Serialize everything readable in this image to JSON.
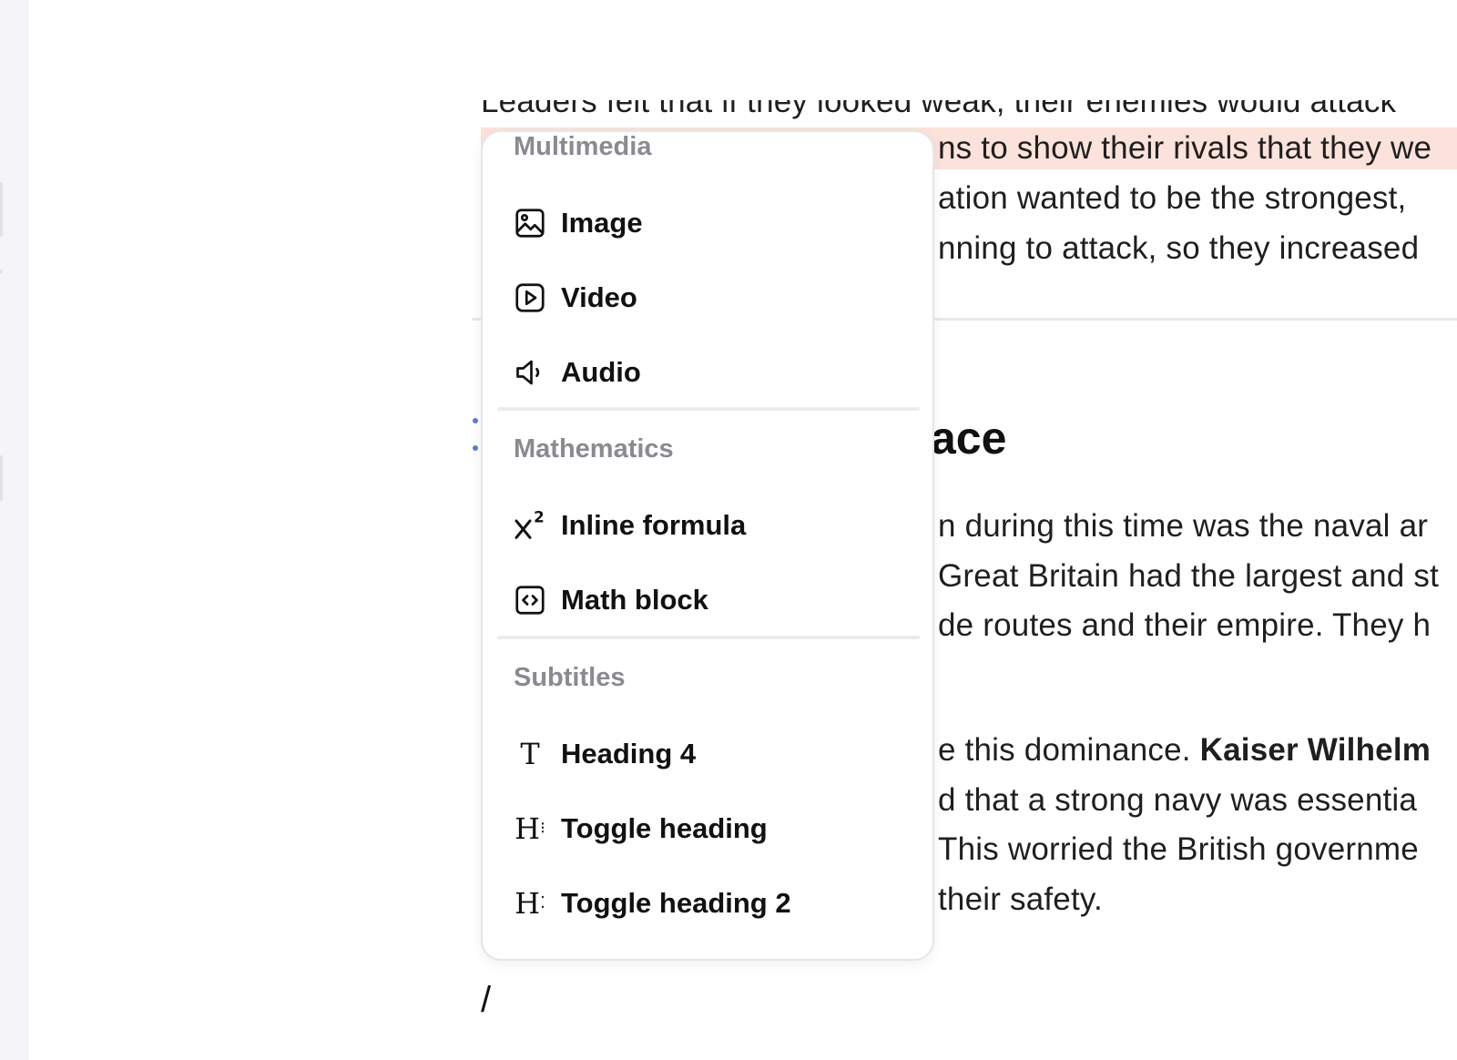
{
  "document": {
    "partial_top_line": "Leaders felt that if they looked weak, their enemies would attack",
    "para1_lines": [
      "ns to show their rivals that they we",
      "ation wanted to be the strongest,",
      "nning to attack, so they increased"
    ],
    "heading_fragment": "ace",
    "para2_lines": [
      "n during this time was the naval ar",
      "Great Britain had the largest and st",
      "de routes and their empire. They h"
    ],
    "para3_line1_prefix": "e this dominance. ",
    "para3_line1_bold": "Kaiser Wilhelm",
    "para3_lines": [
      "d that a strong navy was essentia",
      "This worried the British governme",
      "their safety."
    ],
    "slash_command": "/"
  },
  "menu": {
    "groups": [
      {
        "label": "Multimedia",
        "items": [
          {
            "label": "Image",
            "icon": "image-icon"
          },
          {
            "label": "Video",
            "icon": "video-icon"
          },
          {
            "label": "Audio",
            "icon": "audio-icon"
          }
        ]
      },
      {
        "label": "Mathematics",
        "items": [
          {
            "label": "Inline formula",
            "icon": "superscript-icon"
          },
          {
            "label": "Math block",
            "icon": "code-brackets-icon"
          }
        ]
      },
      {
        "label": "Subtitles",
        "items": [
          {
            "label": "Heading 4",
            "icon": "text-t-icon"
          },
          {
            "label": "Toggle heading",
            "icon": "toggle-heading-icon"
          },
          {
            "label": "Toggle heading 2",
            "icon": "toggle-heading-2-icon"
          }
        ]
      }
    ]
  }
}
